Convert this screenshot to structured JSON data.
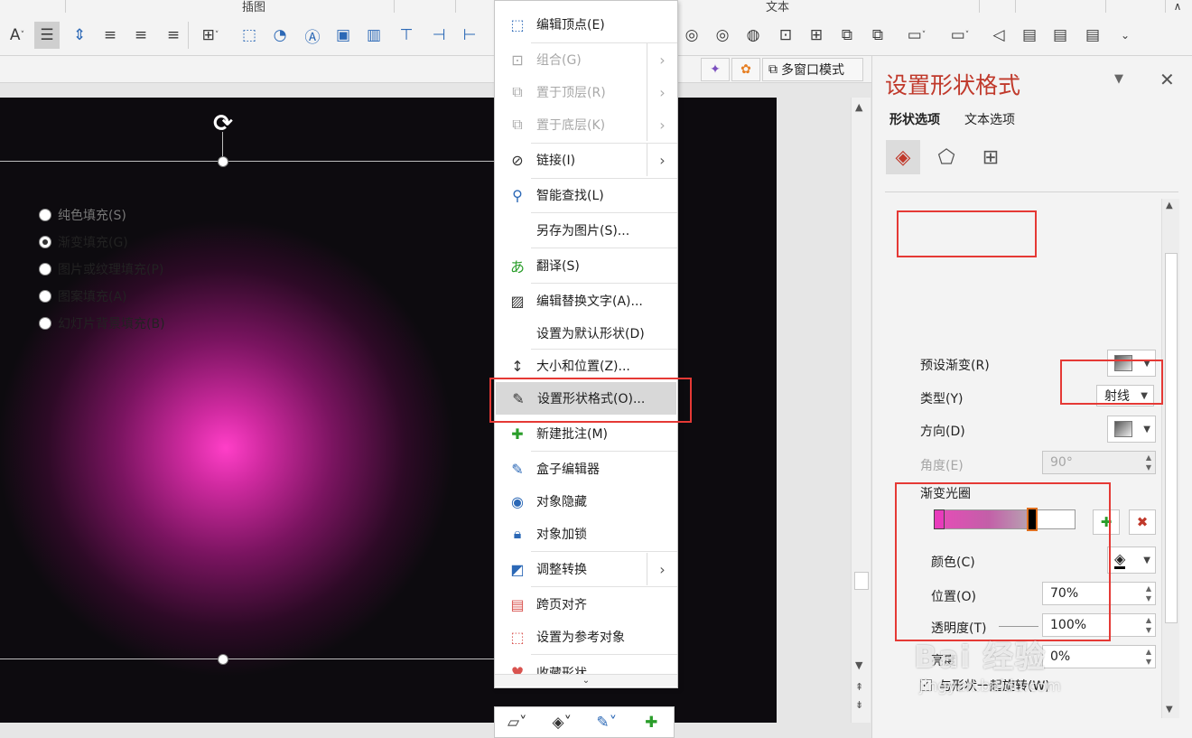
{
  "ribbon": {
    "group_illustration": "插图",
    "group_text": "文本",
    "font_color_glyph": "A",
    "multi_window_label": "多窗口模式"
  },
  "context_menu": {
    "items": [
      {
        "label": "编辑顶点(E)"
      },
      {
        "label": "组合(G)"
      },
      {
        "label": "置于顶层(R)"
      },
      {
        "label": "置于底层(K)"
      },
      {
        "label": "链接(I)"
      },
      {
        "label": "智能查找(L)"
      },
      {
        "label": "另存为图片(S)..."
      },
      {
        "label": "翻译(S)"
      },
      {
        "label": "编辑替换文字(A)..."
      },
      {
        "label": "设置为默认形状(D)"
      },
      {
        "label": "大小和位置(Z)..."
      },
      {
        "label": "设置形状格式(O)..."
      },
      {
        "label": "新建批注(M)"
      },
      {
        "label": "盒子编辑器"
      },
      {
        "label": "对象隐藏"
      },
      {
        "label": "对象加锁"
      },
      {
        "label": "调整转换"
      },
      {
        "label": "跨页对齐"
      },
      {
        "label": "设置为参考对象"
      },
      {
        "label": "收藏形状"
      }
    ],
    "highlighted_item": "设置形状格式(O)..."
  },
  "format_pane": {
    "title": "设置形状格式",
    "tab_shape": "形状选项",
    "tab_text": "文本选项",
    "fill_options": {
      "solid": "纯色填充(S)",
      "gradient": "渐变填充(G)",
      "picture": "图片或纹理填充(P)",
      "pattern": "图案填充(A)",
      "slide_bg": "幻灯片背景填充(B)"
    },
    "selected_fill": "渐变填充(G)",
    "preset_label": "预设渐变(R)",
    "type_label": "类型(Y)",
    "type_value": "射线",
    "direction_label": "方向(D)",
    "angle_label": "角度(E)",
    "angle_value": "90°",
    "stops_label": "渐变光圈",
    "color_label": "颜色(C)",
    "position_label": "位置(O)",
    "position_value": "70%",
    "transparency_label": "透明度(T)",
    "transparency_value": "100%",
    "brightness_label": "亮度",
    "brightness_value": "0%",
    "rotate_label": "与形状一起旋转(W)",
    "rotate_checked": true
  },
  "gradient": {
    "stop1_color": "#e83bbb",
    "stop2_color": "#000000",
    "stop2_position_percent": 70
  },
  "watermark": {
    "main": "Bai 经验",
    "sub": "jingyan.baidu.com"
  },
  "colors": {
    "accent_red": "#c0392b",
    "highlight_box": "#e53935",
    "glow_center": "#ff3fc8",
    "slide_bg": "#0d0b0f"
  }
}
